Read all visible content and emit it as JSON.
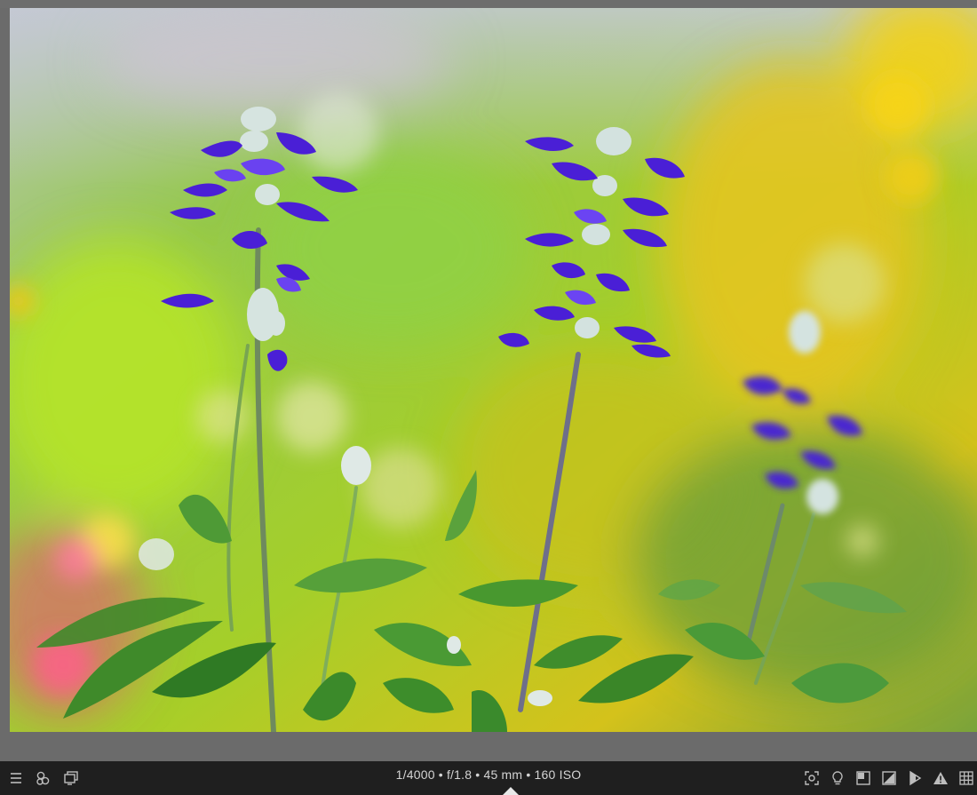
{
  "photo": {
    "subject": "blue salvia flowers in garden"
  },
  "bottombar": {
    "exif_text": "1/4000 • f/1.8 • 45 mm • 160 ISO",
    "left_icons": [
      "menu-icon",
      "color-labels-icon",
      "display-icon"
    ],
    "right_icons": [
      "focus-peaking-icon",
      "idea-icon",
      "before-after-icon",
      "exposure-icon",
      "softproof-icon",
      "clipping-warning-icon",
      "grid-icon"
    ]
  }
}
